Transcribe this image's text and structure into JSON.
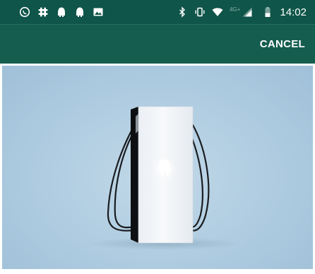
{
  "status_bar": {
    "time": "14:02",
    "network_label": "4G+",
    "left_icons": [
      "whatsapp-icon",
      "slack-icon",
      "app-notification-icon",
      "app-notification-icon",
      "image-icon"
    ],
    "right_icons": [
      "bluetooth-icon",
      "vibrate-icon",
      "wifi-icon",
      "signal-icon",
      "battery-icon"
    ]
  },
  "app_bar": {
    "cancel_label": "CANCEL"
  },
  "hero": {
    "image_subject": "ev-charger-with-cables",
    "logo_icon": "charger-logo-icon"
  },
  "colors": {
    "status_bar": "#0f5549",
    "app_bar": "#155d4f",
    "hero_background": "#aecbe0"
  }
}
